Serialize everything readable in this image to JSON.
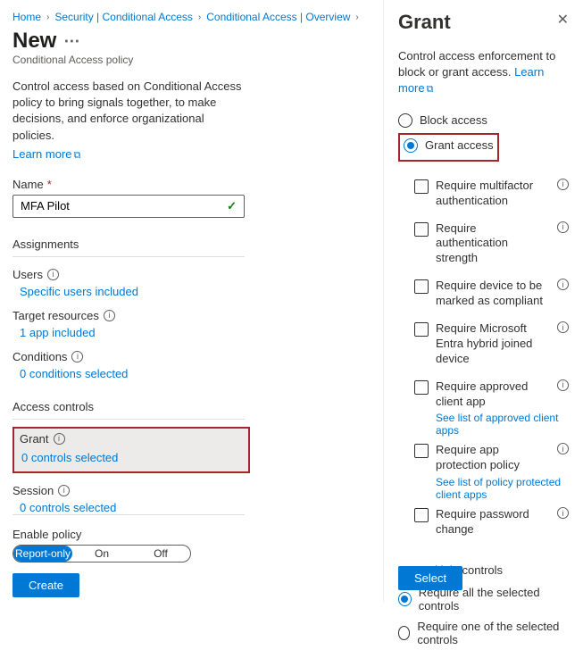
{
  "breadcrumb": {
    "home": "Home",
    "security": "Security | Conditional Access",
    "overview": "Conditional Access | Overview"
  },
  "page": {
    "title": "New",
    "subtitle": "Conditional Access policy",
    "description": "Control access based on Conditional Access policy to bring signals together, to make decisions, and enforce organizational policies.",
    "learn_more": "Learn more"
  },
  "form": {
    "name_label": "Name",
    "name_value": "MFA Pilot",
    "assignments_heading": "Assignments",
    "users_label": "Users",
    "users_value": "Specific users included",
    "targets_label": "Target resources",
    "targets_value": "1 app included",
    "conditions_label": "Conditions",
    "conditions_value": "0 conditions selected",
    "access_controls_heading": "Access controls",
    "grant_label": "Grant",
    "grant_value": "0 controls selected",
    "session_label": "Session",
    "session_value": "0 controls selected",
    "enable_label": "Enable policy",
    "enable_options": {
      "report": "Report-only",
      "on": "On",
      "off": "Off"
    },
    "create_btn": "Create"
  },
  "panel": {
    "title": "Grant",
    "description": "Control access enforcement to block or grant access.",
    "learn_more": "Learn more",
    "block_label": "Block access",
    "grant_label": "Grant access",
    "checks": {
      "mfa": "Require multifactor authentication",
      "strength": "Require authentication strength",
      "compliant": "Require device to be marked as compliant",
      "hybrid": "Require Microsoft Entra hybrid joined device",
      "approved_app": "Require approved client app",
      "approved_app_link": "See list of approved client apps",
      "protection": "Require app protection policy",
      "protection_link": "See list of policy protected client apps",
      "password": "Require password change"
    },
    "multiple_heading": "For multiple controls",
    "require_all": "Require all the selected controls",
    "require_one": "Require one of the selected controls",
    "select_btn": "Select"
  }
}
